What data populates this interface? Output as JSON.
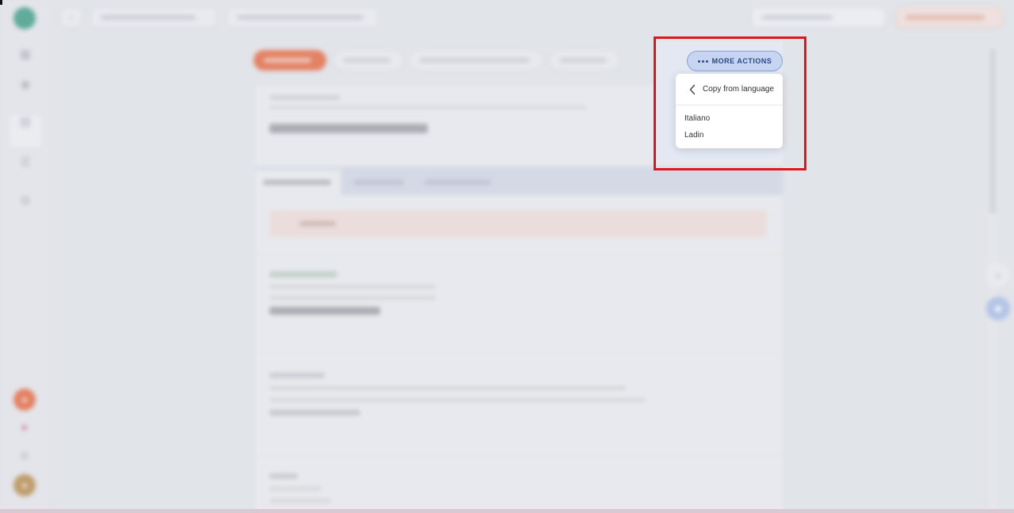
{
  "colors": {
    "accent_orange": "#e8501e",
    "brand_green": "#1f8f74",
    "more_actions_bg": "#c7d5f2",
    "more_actions_text": "#2b4a86",
    "highlight_red": "#e0161d"
  },
  "more_actions": {
    "label": "MORE ACTIONS",
    "icon": "more-dots-icon"
  },
  "dropdown": {
    "header": {
      "icon": "chevron-left-icon",
      "label": "Copy from language"
    },
    "items": [
      {
        "label": "Italiano"
      },
      {
        "label": "Ladin"
      }
    ]
  }
}
